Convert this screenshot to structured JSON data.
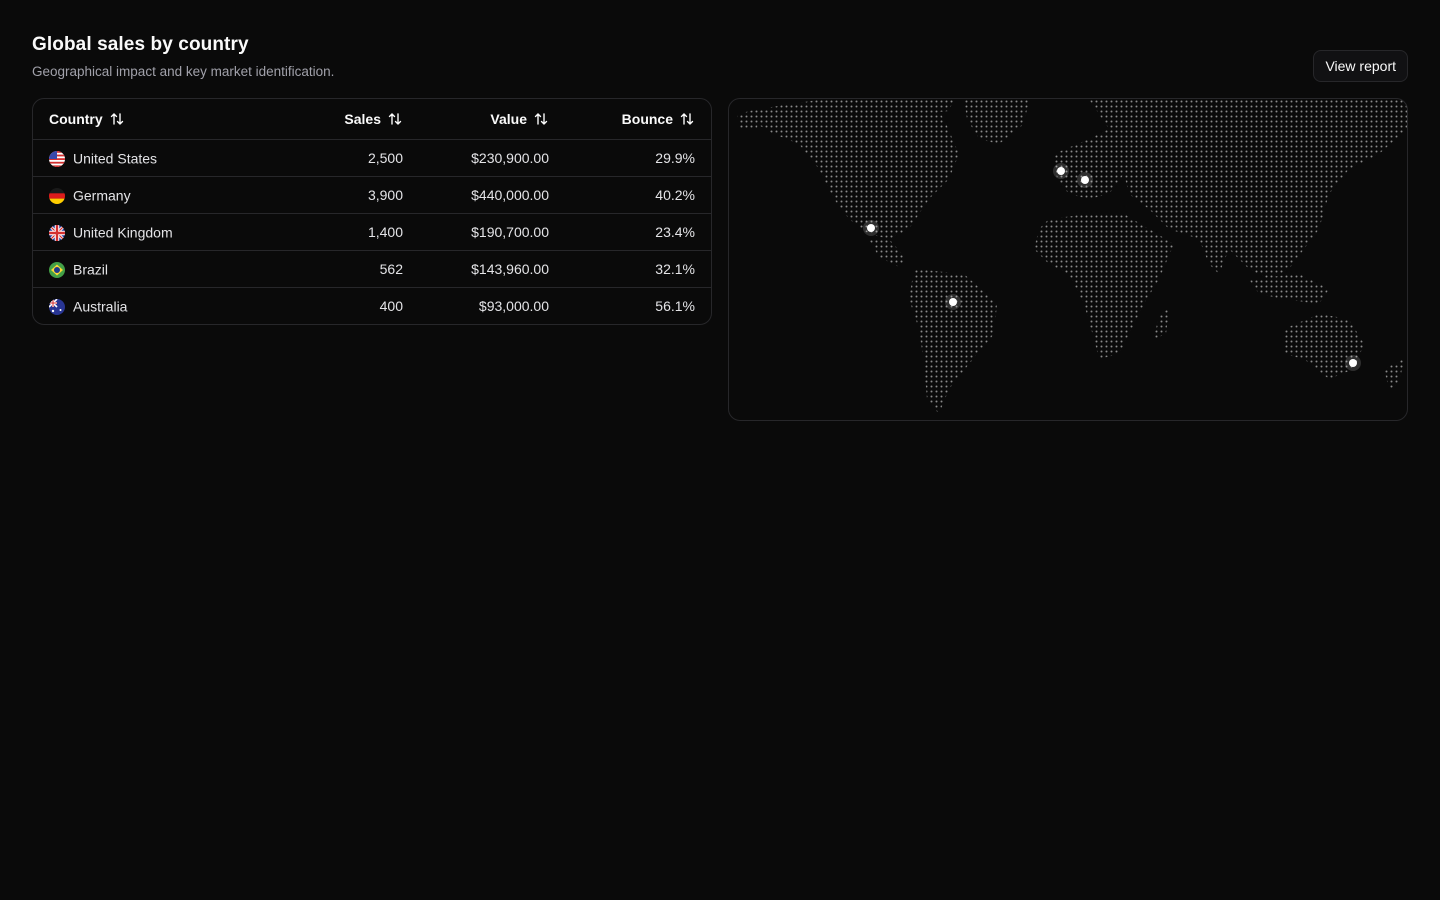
{
  "header": {
    "title": "Global sales by country",
    "subtitle": "Geographical impact and key market identification.",
    "view_report_label": "View report"
  },
  "table": {
    "columns": {
      "country": "Country",
      "sales": "Sales",
      "value": "Value",
      "bounce": "Bounce"
    },
    "rows": [
      {
        "flag": "us-flag-icon",
        "country": "United States",
        "sales": "2,500",
        "value": "$230,900.00",
        "bounce": "29.9%"
      },
      {
        "flag": "de-flag-icon",
        "country": "Germany",
        "sales": "3,900",
        "value": "$440,000.00",
        "bounce": "40.2%"
      },
      {
        "flag": "gb-flag-icon",
        "country": "United Kingdom",
        "sales": "1,400",
        "value": "$190,700.00",
        "bounce": "23.4%"
      },
      {
        "flag": "br-flag-icon",
        "country": "Brazil",
        "sales": "562",
        "value": "$143,960.00",
        "bounce": "32.1%"
      },
      {
        "flag": "au-flag-icon",
        "country": "Australia",
        "sales": "400",
        "value": "$93,000.00",
        "bounce": "56.1%"
      }
    ]
  },
  "map": {
    "markers": [
      "United States",
      "Brazil",
      "United Kingdom",
      "Germany",
      "Australia"
    ]
  },
  "colors": {
    "background": "#0a0a0a",
    "border": "#27272a",
    "muted_text": "#a1a1aa",
    "marker": "#ffffff"
  }
}
